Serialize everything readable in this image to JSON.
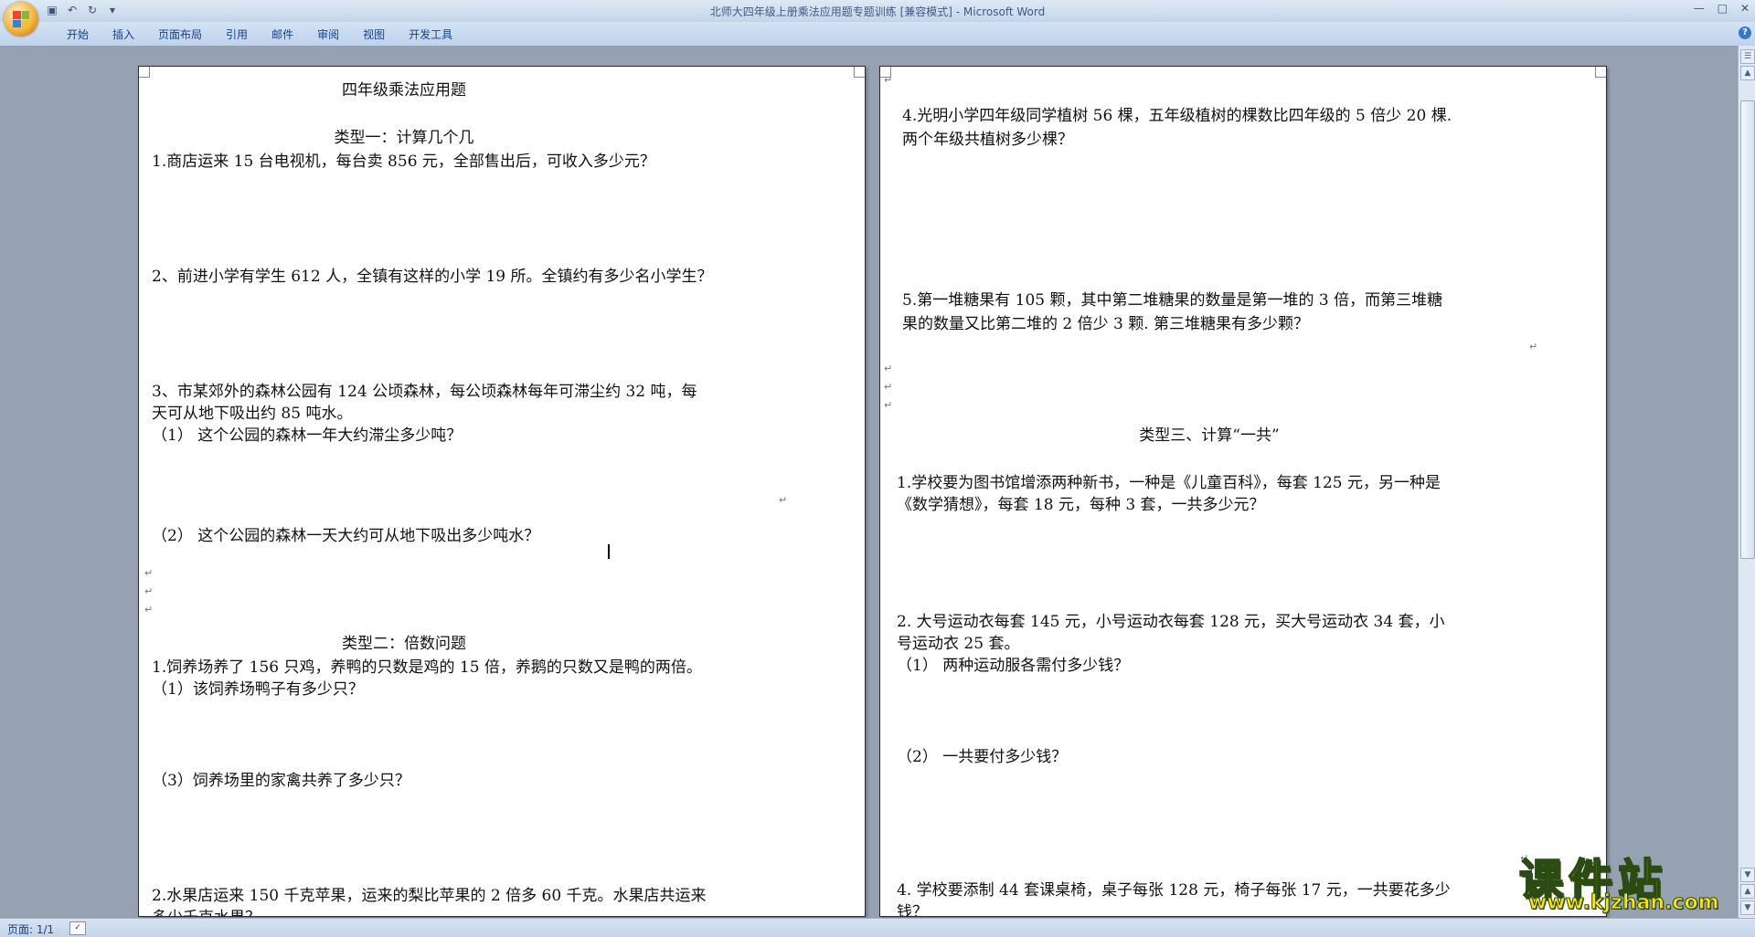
{
  "window": {
    "title": "北师大四年级上册乘法应用题专题训练 [兼容模式] - Microsoft Word"
  },
  "quick_access": {
    "save_icon": "save-icon",
    "undo_icon": "undo-icon",
    "redo_icon": "redo-icon"
  },
  "ribbon": {
    "tabs": [
      "开始",
      "插入",
      "页面布局",
      "引用",
      "邮件",
      "审阅",
      "视图",
      "开发工具"
    ]
  },
  "left_page": {
    "title": "四年级乘法应用题",
    "heading1": "类型一：计算几个几",
    "q1": "1.商店运来 15 台电视机，每台卖 856 元，全部售出后，可收入多少元？",
    "q2": "2、前进小学有学生 612 人，全镇有这样的小学 19 所。全镇约有多少名小学生？",
    "q3_line1": "3、市某郊外的森林公园有 124 公顷森林，每公顷森林每年可滞尘约 32 吨，每",
    "q3_line2": "天可从地下吸出约 85 吨水。",
    "q3_sub1": "（1）   这个公园的森林一年大约滞尘多少吨？",
    "q3_sub2": "（2）   这个公园的森林一天大约可从地下吸出多少吨水？",
    "heading2": "类型二：倍数问题",
    "q4": "1.饲养场养了 156 只鸡，养鸭的只数是鸡的 15 倍，养鹅的只数又是鸭的两倍。",
    "q4_sub1": "（1）该饲养场鸭子有多少只？",
    "q4_sub3": "（3）饲养场里的家禽共养了多少只？",
    "q5_line1": "2.水果店运来 150 千克苹果，运来的梨比苹果的 2 倍多 60 千克。水果店共运来",
    "q5_line2": "多少千克水果？"
  },
  "right_page": {
    "q4_line1": "4.光明小学四年级同学植树 56 棵，五年级植树的棵数比四年级的 5 倍少 20 棵.",
    "q4_line2": "两个年级共植树多少棵？",
    "q5_line1": "5.第一堆糖果有 105 颗，其中第二堆糖果的数量是第一堆的 3 倍，而第三堆糖",
    "q5_line2": "果的数量又比第二堆的 2 倍少 3 颗. 第三堆糖果有多少颗？",
    "heading3": "类型三、计算“一共”",
    "q6_line1": "1.学校要为图书馆增添两种新书，一种是《儿童百科》，每套 125 元，另一种是",
    "q6_line2": "《数学猜想》，每套 18 元，每种 3 套，一共多少元？",
    "q7_line1": "2. 大号运动衣每套 145 元，小号运动衣每套 128 元，买大号运动衣 34 套，小",
    "q7_line2": "号运动衣 25 套。",
    "q7_sub1": "（1）  两种运动服各需付多少钱？",
    "q7_sub2": "（2） 一共要付多少钱？",
    "q8_line1": "4. 学校要添制 44 套课桌椅，桌子每张 128 元，椅子每张 17 元，一共要花多少",
    "q8_line2": "钱？"
  },
  "paragraph_mark": "↵",
  "status": {
    "page": "页面: 1/1"
  },
  "watermark": {
    "big": "课件站",
    "small": "www.kjzhan.com"
  }
}
